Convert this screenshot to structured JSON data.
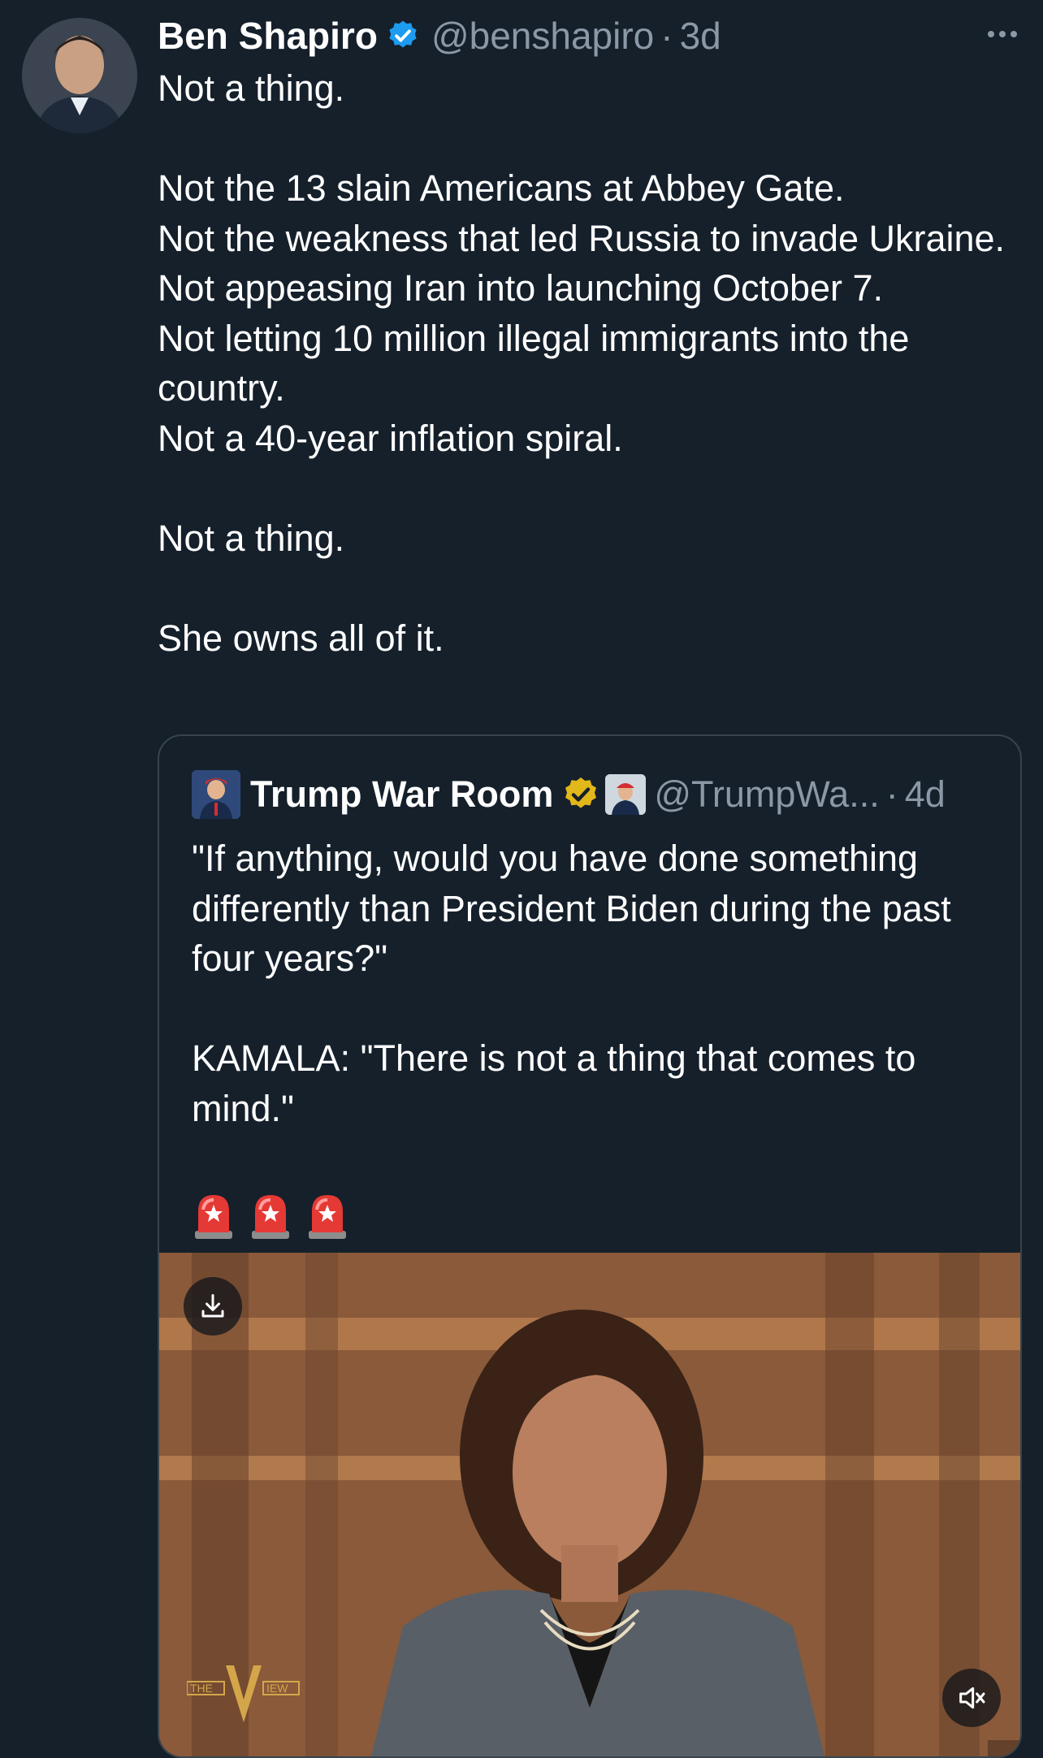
{
  "tweet": {
    "author_name": "Ben Shapiro",
    "author_handle": "@benshapiro",
    "separator": "·",
    "time": "3d",
    "avatar_icon": "avatar-photo",
    "verified_icon": "verified-badge-blue",
    "more_icon": "more-dots-icon",
    "paragraphs": [
      "Not a thing.",
      "Not the 13 slain Americans at Abbey Gate.\nNot the weakness that led Russia to invade Ukraine.\nNot appeasing Iran into launching October 7.\nNot letting 10 million illegal immigrants into the country.\nNot a 40-year inflation spiral.",
      "Not a thing.",
      "She owns all of it."
    ]
  },
  "quoted": {
    "author_name": "Trump War Room",
    "author_handle": "@TrumpWa...",
    "separator": "·",
    "time": "4d",
    "verified_icon": "verified-badge-gold",
    "affiliation_icon": "affiliate-avatar",
    "paragraphs": [
      "\"If anything, would you have done something differently than President Biden during the past four years?\"",
      "KAMALA: \"There is not a thing that comes to mind.\""
    ],
    "emoji_icons": [
      "siren-emoji",
      "siren-emoji",
      "siren-emoji"
    ],
    "media": {
      "type": "video",
      "watermark_left": "THE",
      "watermark_right": "IEW",
      "download_icon": "download-icon",
      "mute_icon": "muted-speaker-icon"
    }
  },
  "colors": {
    "background": "#15202b",
    "text": "#ffffff",
    "secondary_text": "#8b98a5",
    "border": "#38444d",
    "verified_blue": "#1d9bf0",
    "verified_gold": "#e2b719"
  }
}
